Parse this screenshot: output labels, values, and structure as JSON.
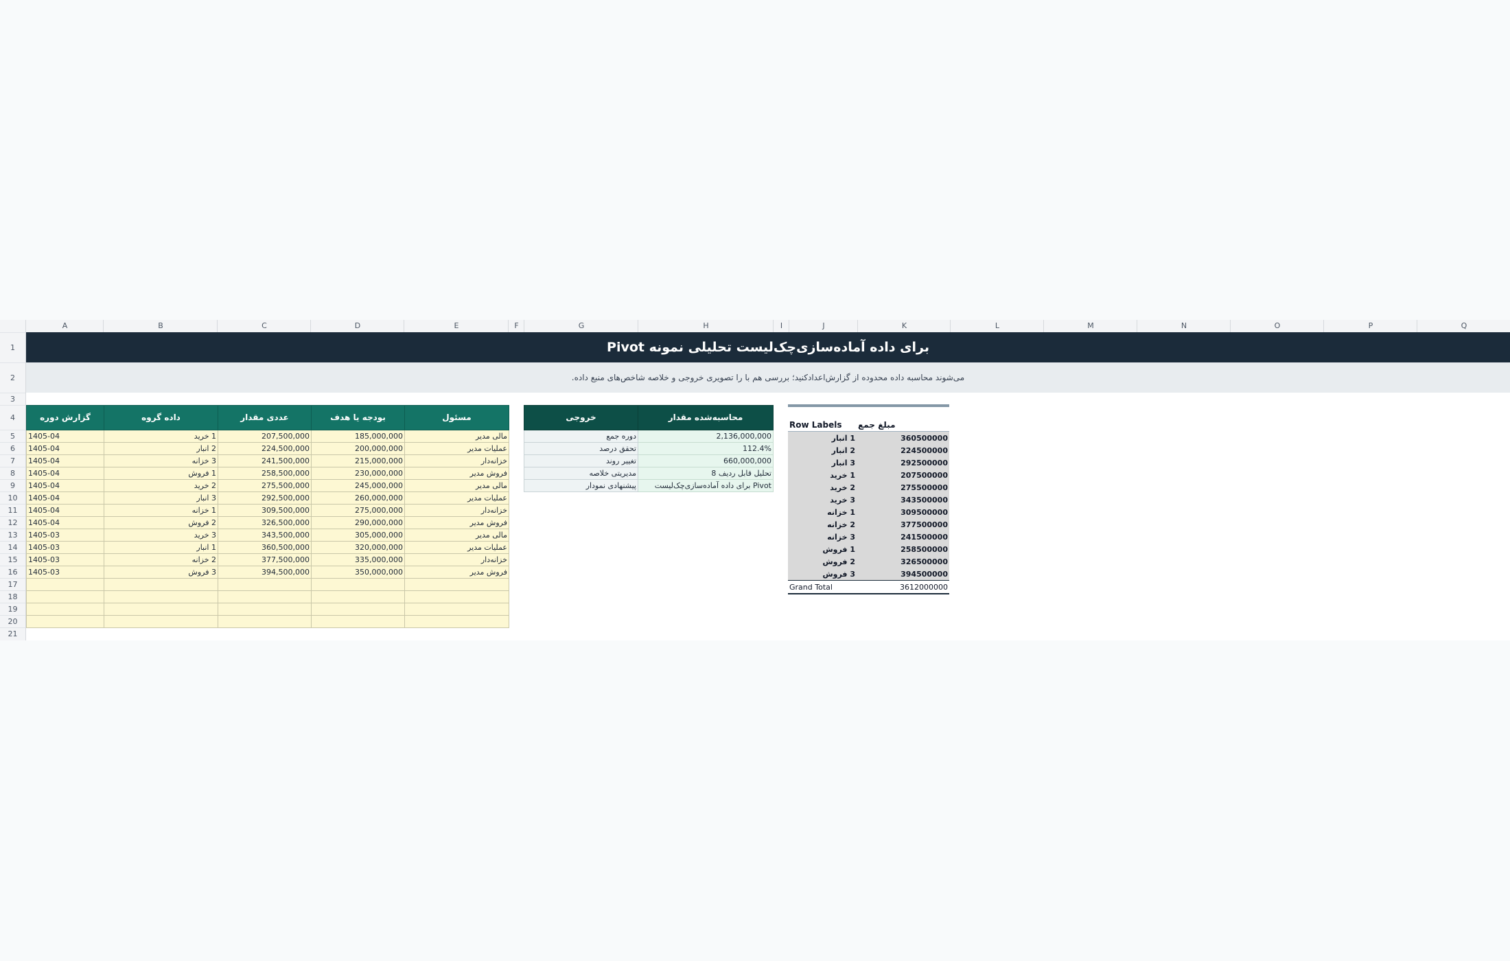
{
  "sheet": {
    "columns": [
      "A",
      "B",
      "C",
      "D",
      "E",
      "F",
      "G",
      "H",
      "I",
      "J",
      "K",
      "L",
      "M",
      "N",
      "O",
      "P",
      "Q"
    ],
    "rows": [
      "1",
      "2",
      "3",
      "4",
      "5",
      "6",
      "7",
      "8",
      "9",
      "10",
      "11",
      "12",
      "13",
      "14",
      "15",
      "16",
      "17",
      "18",
      "19",
      "20",
      "21"
    ],
    "title": "Pivot برای داده آماده‌سازی‌چک‌لیست تحلیلی نمونه",
    "subtitle": ".می‌شوند محاسبه داده محدوده از گزارش‌اعدادکنید؛ بررسی هم با را تصویری خروجی و خلاصه شاخص‌های ‌منبع داده"
  },
  "data_table": {
    "headers": [
      "گزارش دوره",
      "داده گروه",
      "عددی مقدار",
      "بودجه یا هدف",
      "مسئول"
    ],
    "rows": [
      [
        "1405-04",
        "1 خرید",
        "207,500,000",
        "185,000,000",
        "مالی مدیر"
      ],
      [
        "1405-04",
        "2 انبار",
        "224,500,000",
        "200,000,000",
        "عملیات مدیر"
      ],
      [
        "1405-04",
        "3 خزانه",
        "241,500,000",
        "215,000,000",
        "خزانه‌دار"
      ],
      [
        "1405-04",
        "1 فروش",
        "258,500,000",
        "230,000,000",
        "فروش مدیر"
      ],
      [
        "1405-04",
        "2 خرید",
        "275,500,000",
        "245,000,000",
        "مالی مدیر"
      ],
      [
        "1405-04",
        "3 انبار",
        "292,500,000",
        "260,000,000",
        "عملیات مدیر"
      ],
      [
        "1405-04",
        "1 خزانه",
        "309,500,000",
        "275,000,000",
        "خزانه‌دار"
      ],
      [
        "1405-04",
        "2 فروش",
        "326,500,000",
        "290,000,000",
        "فروش مدیر"
      ],
      [
        "1405-03",
        "3 خرید",
        "343,500,000",
        "305,000,000",
        "مالی مدیر"
      ],
      [
        "1405-03",
        "1 انبار",
        "360,500,000",
        "320,000,000",
        "عملیات مدیر"
      ],
      [
        "1405-03",
        "2 خزانه",
        "377,500,000",
        "335,000,000",
        "خزانه‌دار"
      ],
      [
        "1405-03",
        "3 فروش",
        "394,500,000",
        "350,000,000",
        "فروش مدیر"
      ],
      [
        "",
        "",
        "",
        "",
        ""
      ],
      [
        "",
        "",
        "",
        "",
        ""
      ],
      [
        "",
        "",
        "",
        "",
        ""
      ],
      [
        "",
        "",
        "",
        "",
        ""
      ]
    ]
  },
  "calc_table": {
    "headers": [
      "خروجی",
      "محاسبه‌شده مقدار"
    ],
    "rows": [
      [
        "دوره جمع",
        "2,136,000,000"
      ],
      [
        "تحقق درصد",
        "112.4%"
      ],
      [
        "تغییر روند",
        "660,000,000"
      ],
      [
        "مدیریتی خلاصه",
        "تحلیل قابل ردیف 8"
      ],
      [
        "پیشنهادی نمودار",
        "Pivot برای داده آماده‌سازی‌چک‌لیست"
      ]
    ]
  },
  "pivot": {
    "headers": [
      "Row Labels",
      "مبلغ جمع"
    ],
    "rows": [
      [
        "1 انبار",
        "360500000"
      ],
      [
        "2 انبار",
        "224500000"
      ],
      [
        "3 انبار",
        "292500000"
      ],
      [
        "1 خرید",
        "207500000"
      ],
      [
        "2 خرید",
        "275500000"
      ],
      [
        "3 خرید",
        "343500000"
      ],
      [
        "1 خزانه",
        "309500000"
      ],
      [
        "2 خزانه",
        "377500000"
      ],
      [
        "3 خزانه",
        "241500000"
      ],
      [
        "1 فروش",
        "258500000"
      ],
      [
        "2 فروش",
        "326500000"
      ],
      [
        "3 فروش",
        "394500000"
      ]
    ],
    "total": [
      "Grand Total",
      "3612000000"
    ]
  }
}
